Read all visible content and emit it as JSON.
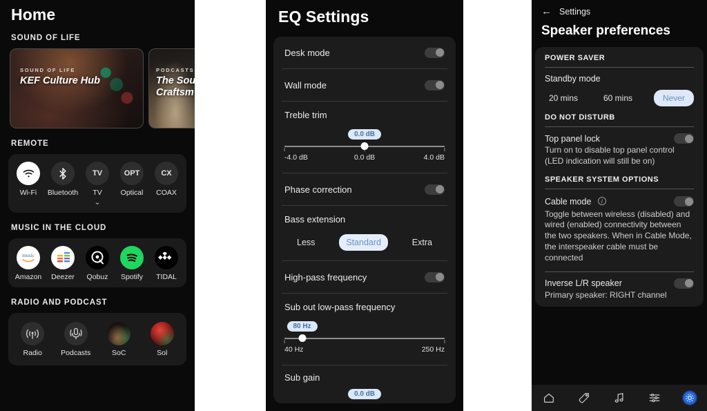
{
  "home": {
    "title": "Home",
    "sections": {
      "sound_of_life": {
        "label": "SOUND OF LIFE",
        "cards": [
          {
            "kicker": "SOUND OF LIFE",
            "title": "KEF Culture Hub"
          },
          {
            "kicker": "PODCASTS",
            "title": "The Sou Craftsm"
          }
        ]
      },
      "remote": {
        "label": "REMOTE",
        "items": [
          {
            "glyph": "wifi-icon",
            "badge": "",
            "label": "Wi-Fi",
            "active": true
          },
          {
            "glyph": "bluetooth-icon",
            "badge": "",
            "label": "Bluetooth",
            "active": false
          },
          {
            "glyph": "text",
            "badge": "TV",
            "label": "TV",
            "active": false,
            "has_chevron": true
          },
          {
            "glyph": "text",
            "badge": "OPT",
            "label": "Optical",
            "active": false
          },
          {
            "glyph": "text",
            "badge": "CX",
            "label": "COAX",
            "active": false
          }
        ],
        "chevron": "⌄"
      },
      "music_cloud": {
        "label": "MUSIC IN THE CLOUD",
        "items": [
          {
            "label": "Amazon",
            "icon": "amazon-music-icon",
            "color": "#ffffff"
          },
          {
            "label": "Deezer",
            "icon": "deezer-icon",
            "color": "#ffffff"
          },
          {
            "label": "Qobuz",
            "icon": "qobuz-icon",
            "color": "#000000"
          },
          {
            "label": "Spotify",
            "icon": "spotify-icon",
            "color": "#1ed760"
          },
          {
            "label": "TIDAL",
            "icon": "tidal-icon",
            "color": "#000000"
          }
        ]
      },
      "radio_podcast": {
        "label": "RADIO AND PODCAST",
        "items": [
          {
            "label": "Radio",
            "icon": "radio-antenna-icon",
            "color": "#2e2e2e"
          },
          {
            "label": "Podcasts",
            "icon": "podcast-mic-icon",
            "color": "#2e2e2e"
          },
          {
            "label": "SoC",
            "icon": "soc-artwork-icon",
            "color": "#1d1a17"
          },
          {
            "label": "Sol",
            "icon": "sol-artwork-icon",
            "color": "#8e1212"
          }
        ]
      }
    }
  },
  "eq": {
    "title": "EQ Settings",
    "rows": [
      {
        "type": "toggle",
        "label": "Desk mode",
        "value": "off"
      },
      {
        "type": "toggle",
        "label": "Wall mode",
        "value": "off"
      },
      {
        "type": "slider",
        "label": "Treble trim",
        "bubble": "0.0 dB",
        "position_pct": 50,
        "scale": {
          "left": "-4.0 dB",
          "mid": "0.0 dB",
          "right": "4.0 dB"
        }
      },
      {
        "type": "toggle",
        "label": "Phase correction",
        "value": "off"
      },
      {
        "type": "segmented",
        "label": "Bass extension",
        "options": [
          "Less",
          "Standard",
          "Extra"
        ],
        "selected": "Standard"
      },
      {
        "type": "toggle",
        "label": "High-pass frequency",
        "value": "off"
      },
      {
        "type": "slider",
        "label": "Sub out low-pass frequency",
        "bubble": "80 Hz",
        "position_pct": 11,
        "scale": {
          "left": "40 Hz",
          "mid": "",
          "right": "250 Hz"
        }
      },
      {
        "type": "slider_partial",
        "label": "Sub gain",
        "bubble": "0.0 dB"
      }
    ]
  },
  "speaker": {
    "back_label": "Settings",
    "title": "Speaker preferences",
    "sections": [
      {
        "heading": "POWER SAVER",
        "items": [
          {
            "title": "Standby mode",
            "options": [
              "20 mins",
              "60 mins",
              "Never"
            ],
            "selected": "Never"
          }
        ]
      },
      {
        "heading": "DO NOT DISTURB",
        "items": [
          {
            "title": "Top panel lock",
            "desc": "Turn on to disable top panel control (LED indication will still be on)",
            "toggle": "off"
          }
        ]
      },
      {
        "heading": "SPEAKER SYSTEM OPTIONS",
        "items": [
          {
            "title": "Cable mode",
            "info": "i",
            "desc": "Toggle between wireless (disabled) and wired (enabled) connectivity between the two speakers. When in Cable Mode, the interspeaker cable must be connected",
            "toggle": "off"
          },
          {
            "title": "Inverse L/R speaker",
            "desc": "Primary speaker: RIGHT channel",
            "toggle": "off"
          }
        ]
      }
    ],
    "bottom_nav": [
      {
        "name": "home-icon",
        "selected": false
      },
      {
        "name": "tag-icon",
        "selected": false
      },
      {
        "name": "music-note-icon",
        "selected": false
      },
      {
        "name": "equalizer-sliders-icon",
        "selected": false
      },
      {
        "name": "settings-gear-icon",
        "selected": true
      }
    ]
  },
  "colors": {
    "app_background": "#0a0a0a",
    "card_background": "#1c1c1c",
    "accent_chip_bg": "#dde9f8",
    "accent_chip_text": "#6f8fc2",
    "nav_selected": "#2e6eeb"
  }
}
